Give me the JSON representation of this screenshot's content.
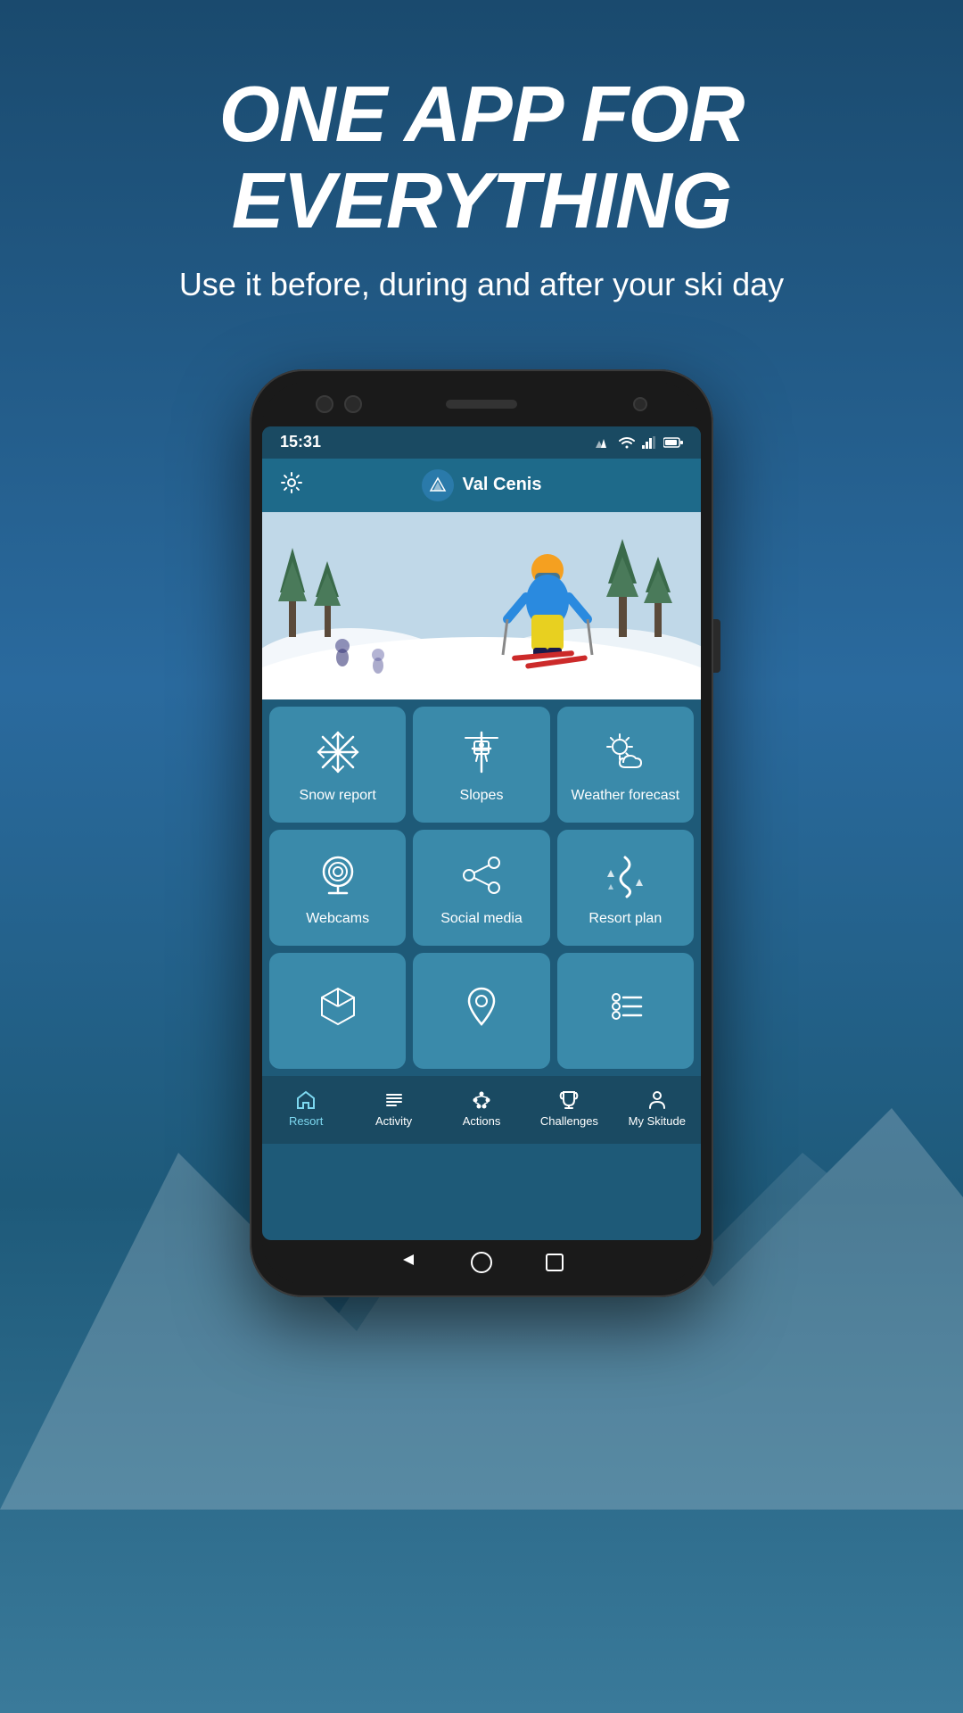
{
  "background": {
    "color_top": "#1a4a6e",
    "color_bottom": "#2a6a9e"
  },
  "header": {
    "main_title": "ONE APP FOR EVERYTHING",
    "subtitle": "Use it before, during and after your ski day"
  },
  "phone": {
    "status_bar": {
      "time": "15:31",
      "icons": [
        "signal",
        "wifi",
        "battery"
      ]
    },
    "app_header": {
      "resort_name": "Val Cenis",
      "settings_label": "Settings"
    },
    "menu_grid": [
      {
        "id": "snow-report",
        "label": "Snow report",
        "icon": "snowflake"
      },
      {
        "id": "slopes",
        "label": "Slopes",
        "icon": "chairlift"
      },
      {
        "id": "weather-forecast",
        "label": "Weather forecast",
        "icon": "cloud-sun"
      },
      {
        "id": "webcams",
        "label": "Webcams",
        "icon": "camera"
      },
      {
        "id": "social-media",
        "label": "Social media",
        "icon": "share"
      },
      {
        "id": "resort-plan",
        "label": "Resort plan",
        "icon": "ski-run"
      },
      {
        "id": "box",
        "label": "",
        "icon": "cube"
      },
      {
        "id": "location",
        "label": "",
        "icon": "pin"
      },
      {
        "id": "list",
        "label": "",
        "icon": "checklist"
      }
    ],
    "bottom_nav": [
      {
        "id": "resort",
        "label": "Resort",
        "icon": "home",
        "active": true
      },
      {
        "id": "activity",
        "label": "Activity",
        "icon": "list"
      },
      {
        "id": "actions",
        "label": "Actions",
        "icon": "dots"
      },
      {
        "id": "challenges",
        "label": "Challenges",
        "icon": "trophy"
      },
      {
        "id": "my-skitude",
        "label": "My Skitude",
        "icon": "person"
      }
    ]
  }
}
